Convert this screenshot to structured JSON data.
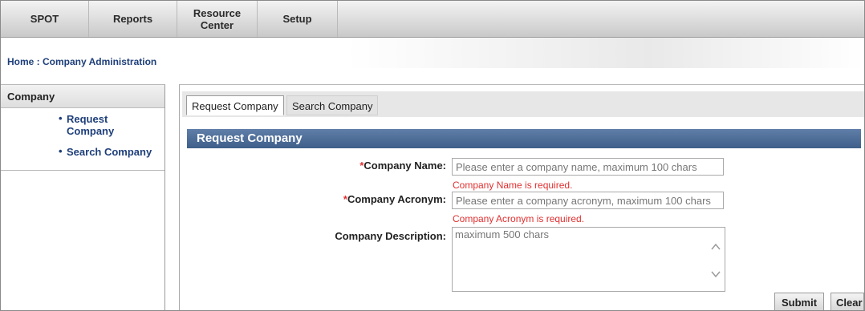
{
  "nav": {
    "items": [
      "SPOT",
      "Reports",
      "Resource Center",
      "Setup"
    ]
  },
  "breadcrumb": "Home : Company Administration",
  "sidebar": {
    "title": "Company",
    "links": [
      "Request Company",
      "Search Company"
    ]
  },
  "tabs": [
    "Request Company",
    "Search Company"
  ],
  "form": {
    "header": "Request Company",
    "company_name": {
      "required_mark": "*",
      "label": "Company Name:",
      "placeholder": "Please enter a company name, maximum 100 chars",
      "value": "",
      "error": "Company Name is required."
    },
    "company_acronym": {
      "required_mark": "*",
      "label": "Company Acronym:",
      "placeholder": "Please enter a company acronym, maximum 100 chars",
      "value": "",
      "error": "Company Acronym is required."
    },
    "company_description": {
      "label": "Company Description:",
      "placeholder": "maximum 500 chars",
      "value": ""
    }
  },
  "buttons": {
    "submit": "Submit",
    "clear": "Clear"
  },
  "colors": {
    "link": "#1e3f7a",
    "header_bar": "#4a6a95",
    "error": "#e03030"
  }
}
